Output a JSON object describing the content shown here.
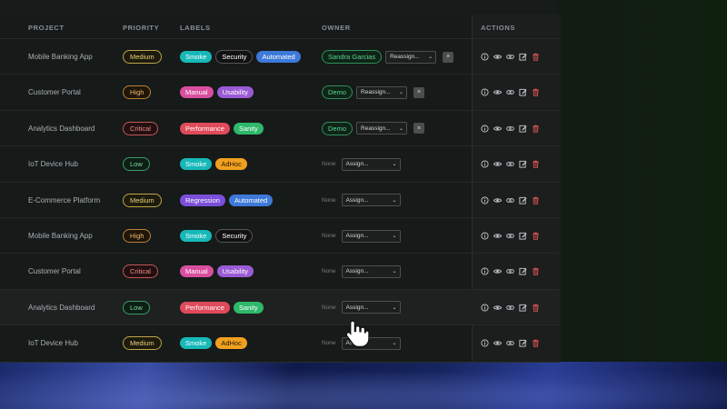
{
  "headers": {
    "project": "PROJECT",
    "priority": "PRIORITY",
    "labels": "LABELS",
    "owner": "OWNER",
    "actions": "ACTIONS"
  },
  "rows": [
    {
      "project": "Mobile Banking App",
      "priority": "Medium",
      "labels": [
        "Smoke",
        "Security",
        "Automated"
      ],
      "owner": "Sandra Garcias",
      "select": "Reassign...",
      "remove": "×"
    },
    {
      "project": "Customer Portal",
      "priority": "High",
      "labels": [
        "Manual",
        "Usability"
      ],
      "owner": "Demo",
      "select": "Reassign...",
      "remove": "×"
    },
    {
      "project": "Analytics Dashboard",
      "priority": "Critical",
      "labels": [
        "Performance",
        "Sanity"
      ],
      "owner": "Demo",
      "select": "Reassign...",
      "remove": "×"
    },
    {
      "project": "IoT Device Hub",
      "priority": "Low",
      "labels": [
        "Smoke",
        "AdHoc"
      ],
      "owner_none": "None",
      "select": "Assign..."
    },
    {
      "project": "E-Commerce Platform",
      "priority": "Medium",
      "labels": [
        "Regression",
        "Automated"
      ],
      "owner_none": "None",
      "select": "Assign..."
    },
    {
      "project": "Mobile Banking App",
      "priority": "High",
      "labels": [
        "Smoke",
        "Security"
      ],
      "owner_none": "None",
      "select": "Assign..."
    },
    {
      "project": "Customer Portal",
      "priority": "Critical",
      "labels": [
        "Manual",
        "Usability"
      ],
      "owner_none": "None",
      "select": "Assign..."
    },
    {
      "project": "Analytics Dashboard",
      "priority": "Low",
      "labels": [
        "Performance",
        "Sanity"
      ],
      "owner_none": "None",
      "select": "Assign..."
    },
    {
      "project": "IoT Device Hub",
      "priority": "Medium",
      "labels": [
        "Smoke",
        "AdHoc"
      ],
      "owner_none": "None",
      "select": "Assign..."
    }
  ],
  "action_icons": [
    "info-icon",
    "eye-icon",
    "link-icon",
    "edit-icon",
    "trash-icon"
  ],
  "colors": {
    "delete": "#e05555",
    "icon": "#c9cdd2",
    "owner_green": "#58d68d"
  }
}
